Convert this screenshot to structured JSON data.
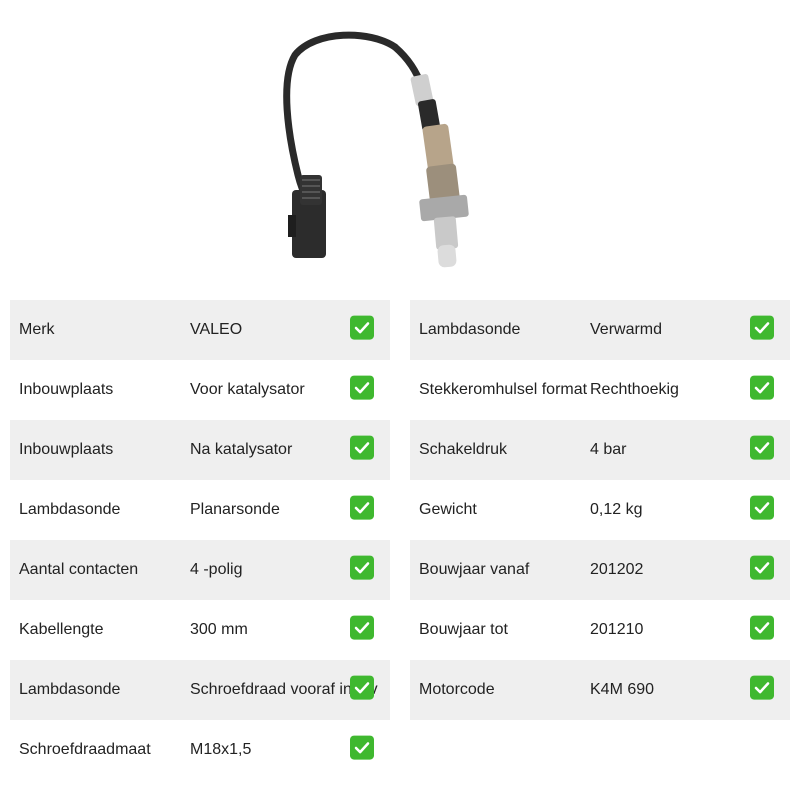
{
  "product": {
    "image_icon": "lambda-sensor-photo"
  },
  "specs_left": [
    {
      "label": "Merk",
      "value": "VALEO"
    },
    {
      "label": "Inbouwplaats",
      "value": "Voor katalysator"
    },
    {
      "label": "Inbouwplaats",
      "value": "Na katalysator"
    },
    {
      "label": "Lambdasonde",
      "value": "Planarsonde"
    },
    {
      "label": "Aantal contacten",
      "value": "4 -polig"
    },
    {
      "label": "Kabellengte",
      "value": "300 mm"
    },
    {
      "label": "Lambdasonde",
      "value": "Schroefdraad vooraf ingev"
    },
    {
      "label": "Schroefdraadmaat",
      "value": "M18x1,5"
    }
  ],
  "specs_right": [
    {
      "label": "Lambdasonde",
      "value": "Verwarmd"
    },
    {
      "label": "Stekkeromhulsel format",
      "value": "Rechthoekig"
    },
    {
      "label": "Schakeldruk",
      "value": "4 bar"
    },
    {
      "label": "Gewicht",
      "value": "0,12 kg"
    },
    {
      "label": "Bouwjaar vanaf",
      "value": "201202"
    },
    {
      "label": "Bouwjaar tot",
      "value": "201210"
    },
    {
      "label": "Motorcode",
      "value": "K4M 690"
    }
  ],
  "icons": {
    "check": "check-mark-icon"
  },
  "colors": {
    "row_shade": "#efefef",
    "check_green": "#3fb82f"
  }
}
